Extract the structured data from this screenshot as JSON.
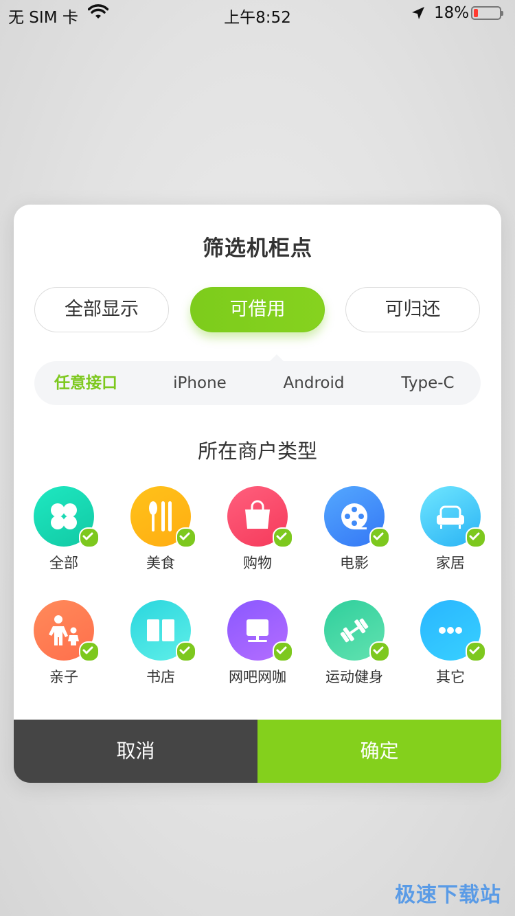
{
  "status_bar": {
    "carrier": "无 SIM 卡",
    "time": "上午8:52",
    "battery_text": "18%",
    "battery_level": 0.18,
    "icons": [
      "wifi-icon",
      "location-arrow-icon",
      "battery-icon"
    ]
  },
  "modal": {
    "title": "筛选机柜点",
    "availability_options": [
      "全部显示",
      "可借用",
      "可归还"
    ],
    "availability_selected": "可借用",
    "port_options": [
      "任意接口",
      "iPhone",
      "Android",
      "Type-C"
    ],
    "port_selected": "任意接口",
    "section_title": "所在商户类型",
    "categories": [
      {
        "label": "全部",
        "icon": "clover-icon",
        "checked": true
      },
      {
        "label": "美食",
        "icon": "utensils-icon",
        "checked": true
      },
      {
        "label": "购物",
        "icon": "shopping-bag-icon",
        "checked": true
      },
      {
        "label": "电影",
        "icon": "film-reel-icon",
        "checked": true
      },
      {
        "label": "家居",
        "icon": "sofa-icon",
        "checked": true
      },
      {
        "label": "亲子",
        "icon": "parent-child-icon",
        "checked": true
      },
      {
        "label": "书店",
        "icon": "book-icon",
        "checked": true
      },
      {
        "label": "网吧网咖",
        "icon": "monitor-icon",
        "checked": true
      },
      {
        "label": "运动健身",
        "icon": "dumbbell-icon",
        "checked": true
      },
      {
        "label": "其它",
        "icon": "more-dots-icon",
        "checked": true
      }
    ],
    "cancel_label": "取消",
    "confirm_label": "确定"
  },
  "colors": {
    "accent": "#84d01c",
    "cancel_bg": "#454545"
  },
  "watermark": "极速下载站"
}
